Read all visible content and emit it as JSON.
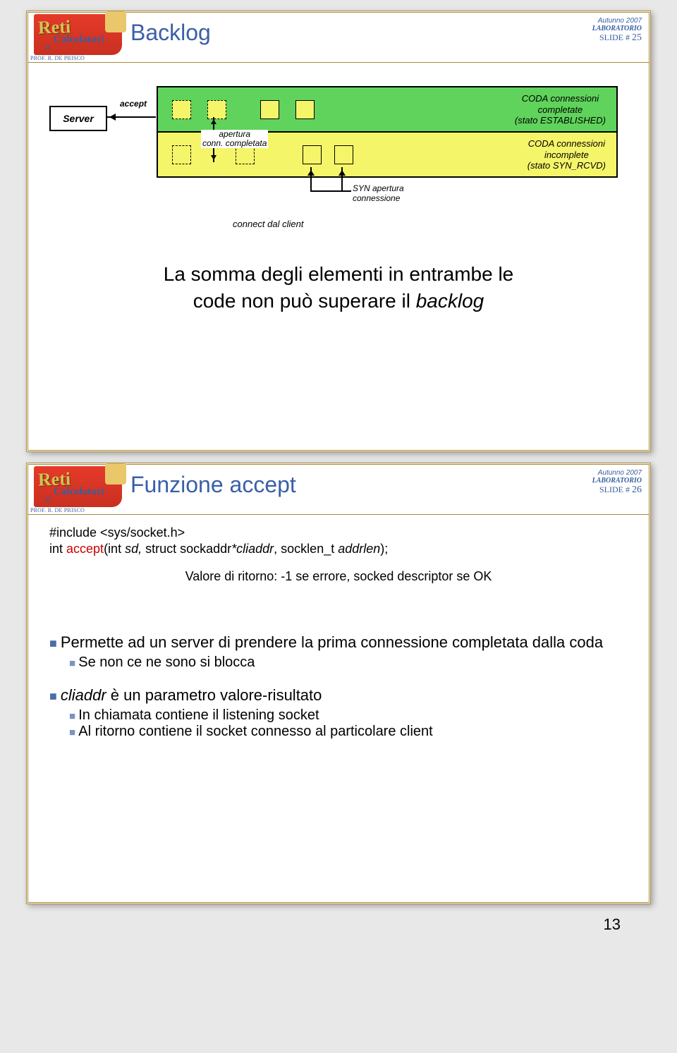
{
  "header_common": {
    "season": "Autunno 2007",
    "lab": "LABORATORIO",
    "slide_label": "SLIDE #",
    "prof": "PROF. R. DE PRISCO",
    "logo_l1": "Reti",
    "logo_l2": "Calcolatori",
    "logo_l3": "di"
  },
  "slide1": {
    "title": "Backlog",
    "num": "25",
    "server": "Server",
    "accept": "accept",
    "apertura": "apertura\nconn. completata",
    "green_label": "CODA connessioni\ncompletate\n(stato ESTABLISHED)",
    "yellow_label": "CODA connessioni\nincomplete\n(stato SYN_RCVD)",
    "syn": "SYN apertura\nconnessione",
    "connect": "connect  dal  client",
    "big": "La somma degli elementi in entrambe le\ncode non può superare il ",
    "big_em": "backlog"
  },
  "slide2": {
    "title": "Funzione accept",
    "num": "26",
    "include": "#include <sys/socket.h>",
    "sig_pre": "int ",
    "sig_kw": "accept",
    "sig_post1": "(int ",
    "sig_em1": "sd, ",
    "sig_post2": "struct sockaddr",
    "sig_em2": "*cliaddr",
    "sig_post3": ", socklen_t ",
    "sig_em3": "addrlen",
    "sig_post4": ");",
    "ret": "Valore di ritorno: -1 se errore, socked descriptor se OK",
    "b1": "Permette ad un server di prendere la prima connessione completata dalla coda",
    "b1a": "Se non ce ne sono si blocca",
    "b2_em": "cliaddr",
    "b2_rest": "  è un parametro valore-risultato",
    "b2a": "In chiamata contiene il listening socket",
    "b2b": "Al ritorno contiene il socket connesso al particolare client"
  },
  "pagenum": "13"
}
